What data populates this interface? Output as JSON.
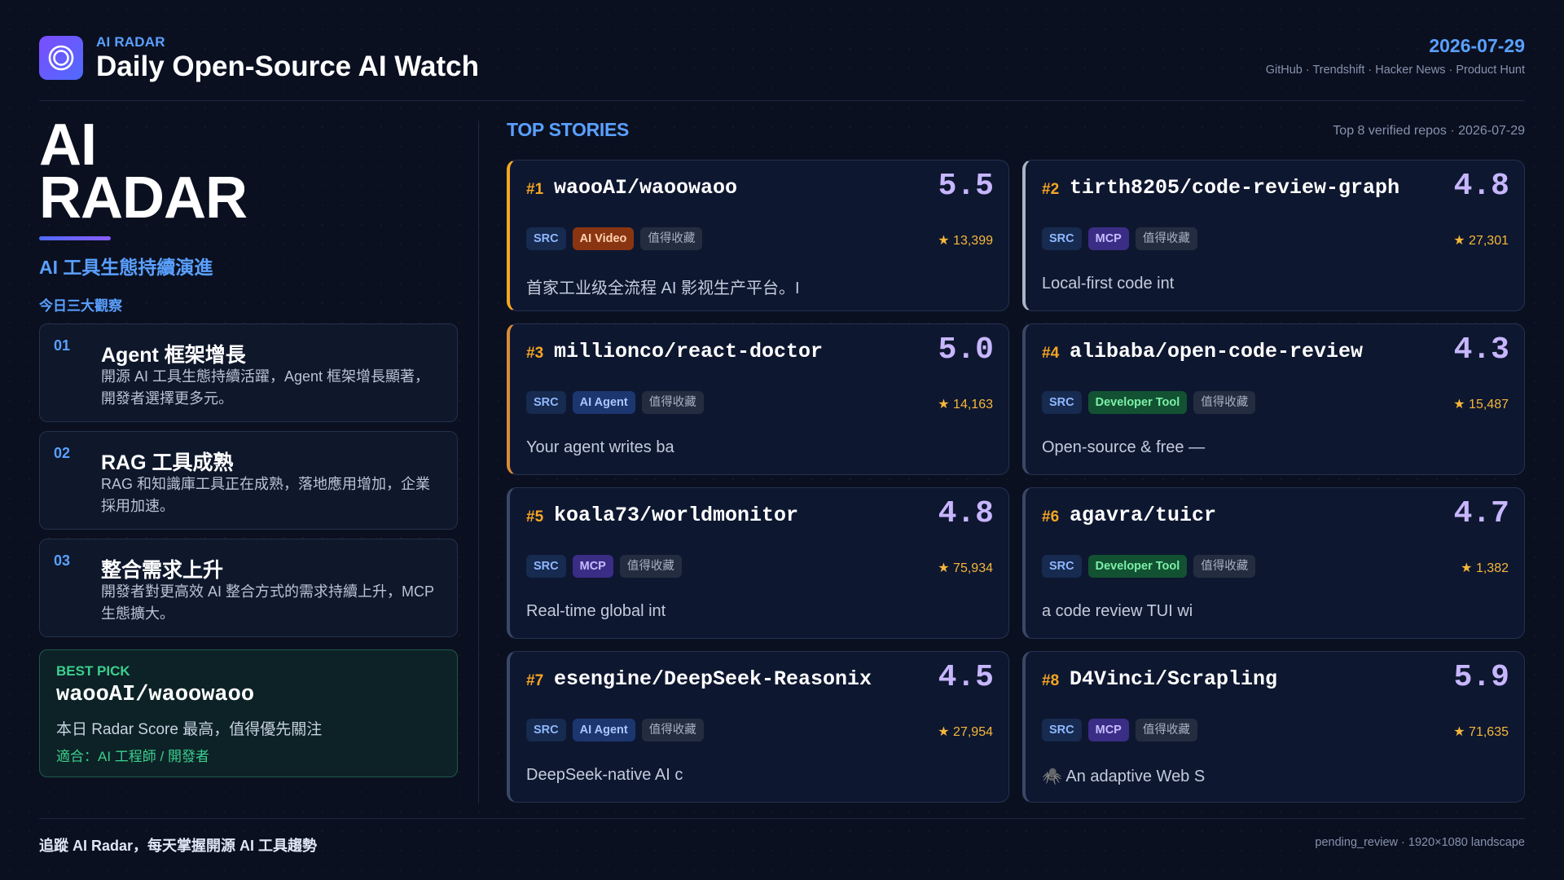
{
  "header": {
    "logo_icon": "concentric-circles-icon",
    "kicker": "AI RADAR",
    "title": "Daily Open-Source AI Watch",
    "date": "2026-07-29",
    "sources": "GitHub · Trendshift · Hacker News · Product Hunt"
  },
  "left": {
    "hero_line1": "AI",
    "hero_line2": "RADAR",
    "subtitle": "AI 工具生態持續演進",
    "section_label": "今日三大觀察",
    "insights": [
      {
        "num": "01",
        "title": "Agent 框架增長",
        "body": "開源 AI 工具生態持續活躍，Agent 框架增長顯著，開發者選擇更多元。"
      },
      {
        "num": "02",
        "title": "RAG 工具成熟",
        "body": "RAG 和知識庫工具正在成熟，落地應用增加，企業採用加速。"
      },
      {
        "num": "03",
        "title": "整合需求上升",
        "body": "開發者對更高效 AI 整合方式的需求持續上升，MCP 生態擴大。"
      }
    ],
    "best_pick": {
      "label": "BEST PICK",
      "repo": "waooAI/waoowaoo",
      "desc": "本日 Radar Score 最高，值得優先關注",
      "fit": "適合：AI 工程師 / 開發者"
    }
  },
  "top": {
    "label": "TOP STORIES",
    "meta": "Top 8 verified repos · 2026-07-29"
  },
  "cards": [
    {
      "rank": "#1",
      "repo": "waooAI/waoowaoo",
      "score": "5.5",
      "src": "SRC",
      "category": "AI Video",
      "save": "值得收藏",
      "stars": "★ 13,399",
      "desc": "首家工业级全流程 AI 影视生产平台。I"
    },
    {
      "rank": "#2",
      "repo": "tirth8205/code-review-graph",
      "score": "4.8",
      "src": "SRC",
      "category": "MCP",
      "save": "值得收藏",
      "stars": "★ 27,301",
      "desc": "Local-first code int"
    },
    {
      "rank": "#3",
      "repo": "millionco/react-doctor",
      "score": "5.0",
      "src": "SRC",
      "category": "AI Agent",
      "save": "值得收藏",
      "stars": "★ 14,163",
      "desc": "Your agent writes ba"
    },
    {
      "rank": "#4",
      "repo": "alibaba/open-code-review",
      "score": "4.3",
      "src": "SRC",
      "category": "Developer Tool",
      "save": "值得收藏",
      "stars": "★ 15,487",
      "desc": "Open-source & free —"
    },
    {
      "rank": "#5",
      "repo": "koala73/worldmonitor",
      "score": "4.8",
      "src": "SRC",
      "category": "MCP",
      "save": "值得收藏",
      "stars": "★ 75,934",
      "desc": "Real-time global int"
    },
    {
      "rank": "#6",
      "repo": "agavra/tuicr",
      "score": "4.7",
      "src": "SRC",
      "category": "Developer Tool",
      "save": "值得收藏",
      "stars": "★ 1,382",
      "desc": "a code review TUI wi"
    },
    {
      "rank": "#7",
      "repo": "esengine/DeepSeek-Reasonix",
      "score": "4.5",
      "src": "SRC",
      "category": "AI Agent",
      "save": "值得收藏",
      "stars": "★ 27,954",
      "desc": "DeepSeek-native AI c"
    },
    {
      "rank": "#8",
      "repo": "D4Vinci/Scrapling",
      "score": "5.9",
      "src": "SRC",
      "category": "MCP",
      "save": "值得收藏",
      "stars": "★ 71,635",
      "desc": "🕷️ An adaptive Web S"
    }
  ],
  "footer": {
    "left": "追蹤 AI Radar，每天掌握開源 AI 工具趨勢",
    "right": "pending_review · 1920×1080 landscape"
  },
  "colors": {
    "background": "#0a1020",
    "accent": "#5aa0ff",
    "score": "#c7b6ff",
    "rank": "#f5a623",
    "best_pick": "#3ccf8e"
  }
}
